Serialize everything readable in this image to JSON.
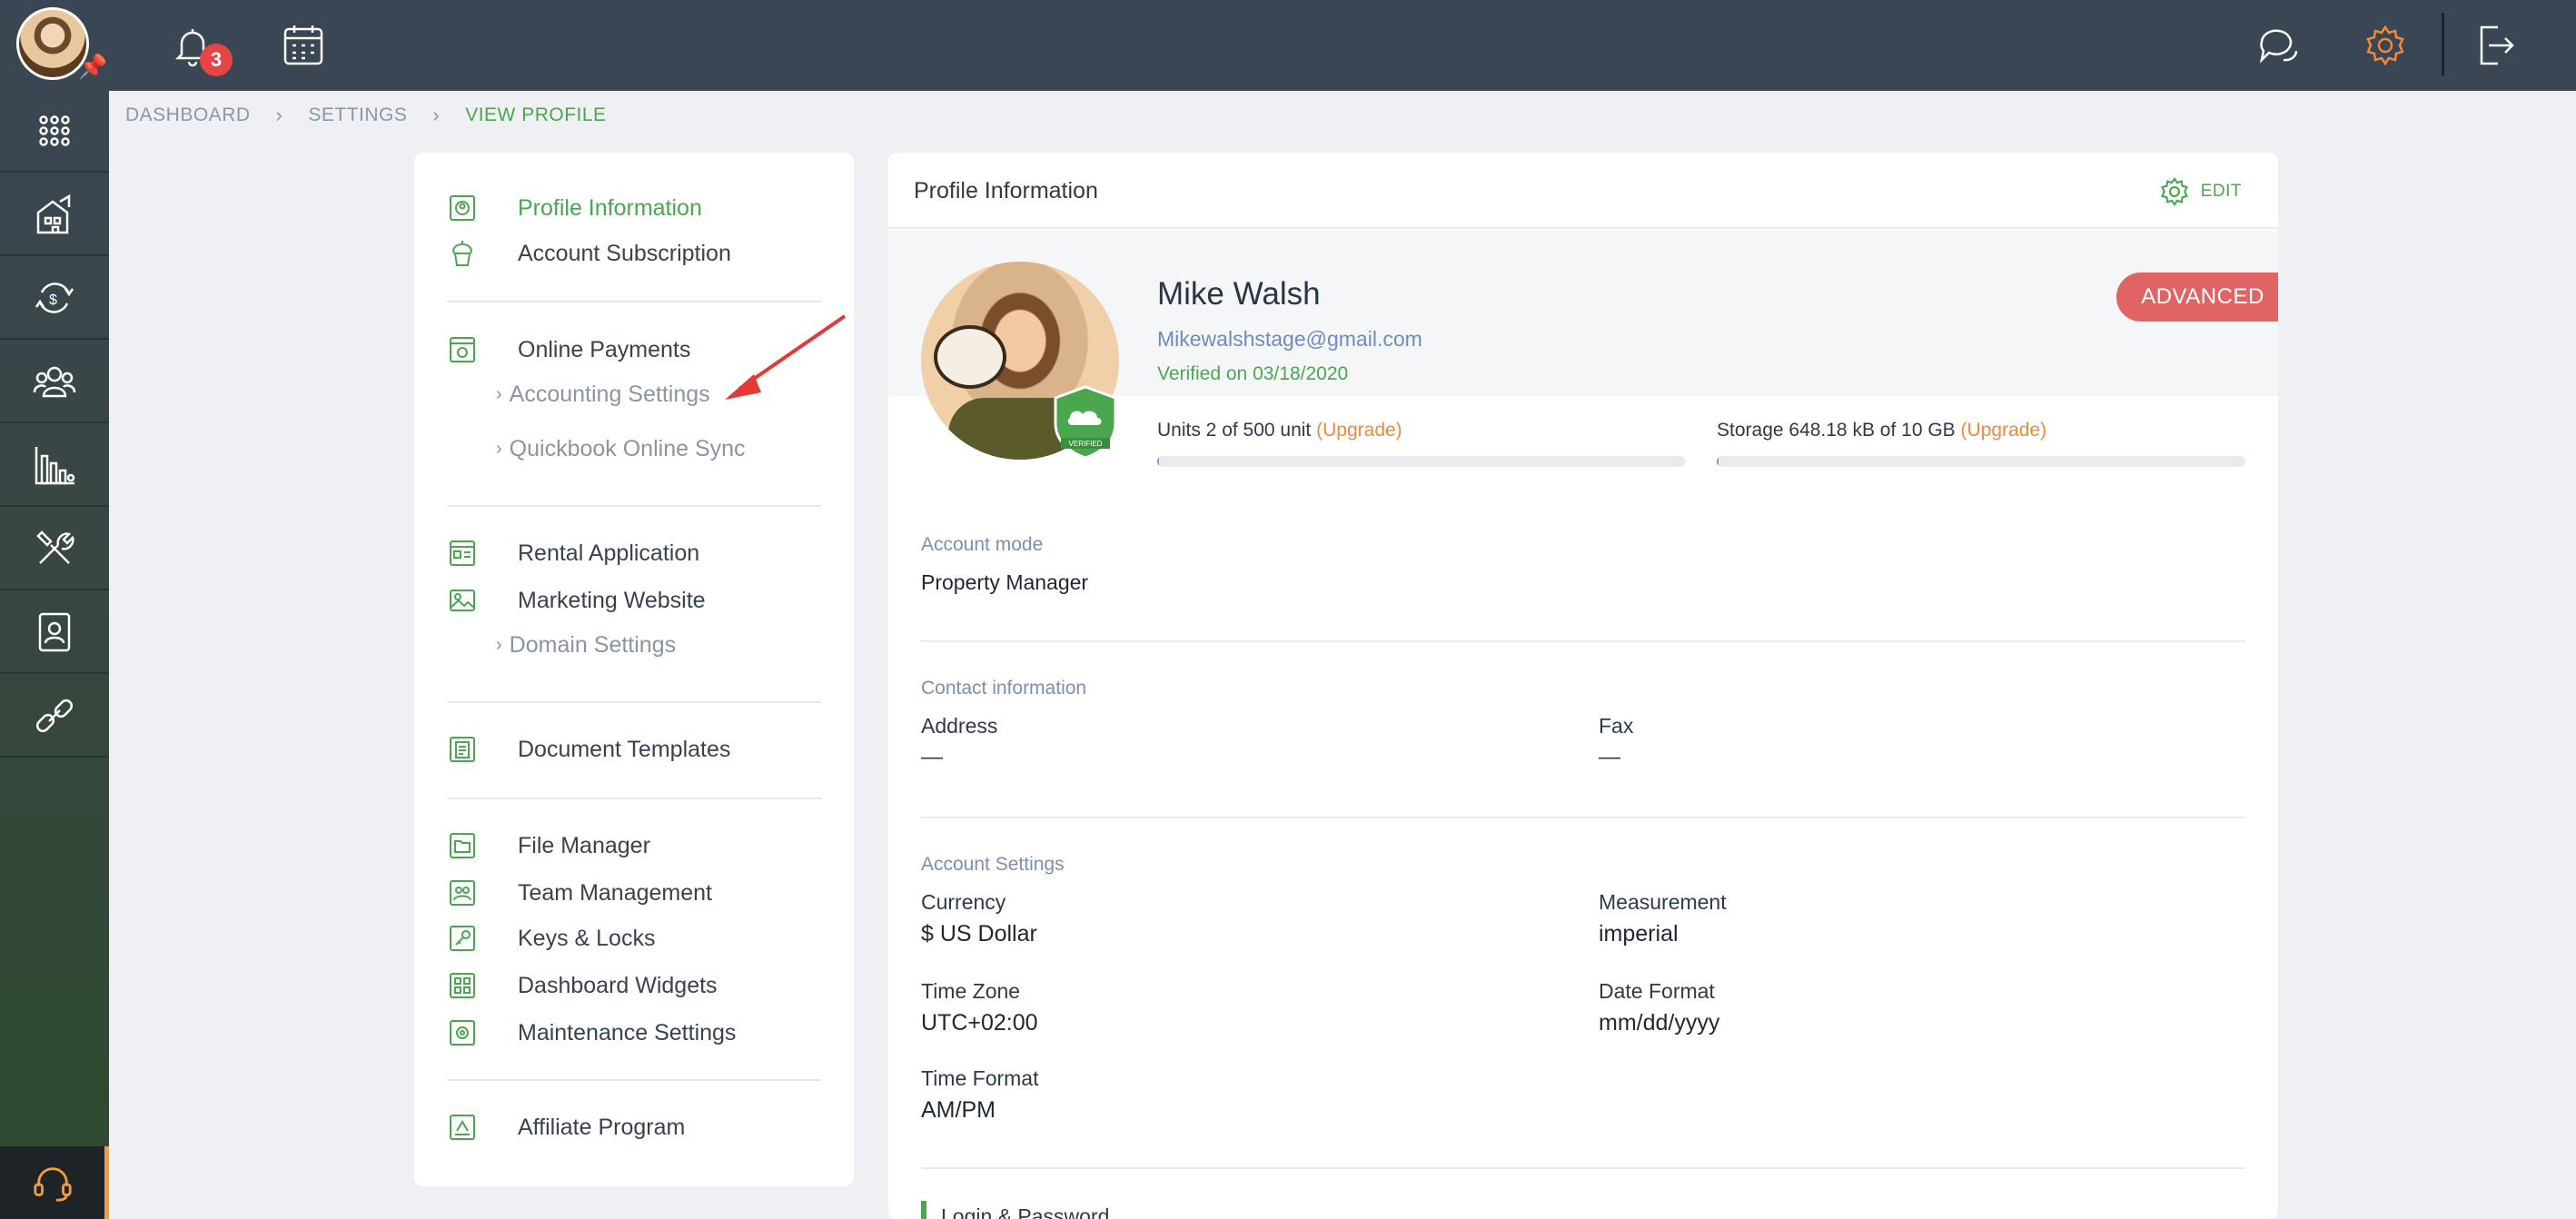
{
  "topbar": {
    "notification_count": "3"
  },
  "breadcrumb": [
    "DASHBOARD",
    "SETTINGS",
    "VIEW PROFILE"
  ],
  "settings_nav": {
    "profile_information": "Profile Information",
    "account_subscription": "Account Subscription",
    "online_payments": "Online Payments",
    "accounting_settings": "Accounting Settings",
    "quickbook_sync": "Quickbook Online Sync",
    "rental_application": "Rental Application",
    "marketing_website": "Marketing Website",
    "domain_settings": "Domain Settings",
    "document_templates": "Document Templates",
    "file_manager": "File Manager",
    "team_management": "Team Management",
    "keys_locks": "Keys & Locks",
    "dashboard_widgets": "Dashboard Widgets",
    "maintenance_settings": "Maintenance Settings",
    "affiliate_program": "Affiliate Program"
  },
  "profile": {
    "panel_title": "Profile Information",
    "edit_label": "EDIT",
    "name": "Mike Walsh",
    "email": "Mikewalshstage@gmail.com",
    "verified_on": "Verified on 03/18/2020",
    "plan": "ADVANCED",
    "badge_text": "VERIFIED",
    "units_label": "Units 2 of 500 unit",
    "storage_label": "Storage 648.18 kB of 10 GB",
    "upgrade_label": "(Upgrade)",
    "units_fraction": 0.004,
    "storage_fraction": 0.0001
  },
  "account_mode": {
    "section": "Account mode",
    "value": "Property Manager"
  },
  "contact": {
    "section": "Contact information",
    "address_label": "Address",
    "address_value": "—",
    "fax_label": "Fax",
    "fax_value": "—"
  },
  "account_settings": {
    "section": "Account Settings",
    "currency_label": "Currency",
    "currency_value": "$ US Dollar",
    "measurement_label": "Measurement",
    "measurement_value": "imperial",
    "timezone_label": "Time Zone",
    "timezone_value": "UTC+02:00",
    "dateformat_label": "Date Format",
    "dateformat_value": "mm/dd/yyyy",
    "timeformat_label": "Time Format",
    "timeformat_value": "AM/PM"
  },
  "login": {
    "section": "Login & Password"
  },
  "colors": {
    "accent_green": "#4aa64f",
    "accent_orange": "#f0883d",
    "plan_red": "#e16464",
    "topbar": "#3b4654"
  }
}
